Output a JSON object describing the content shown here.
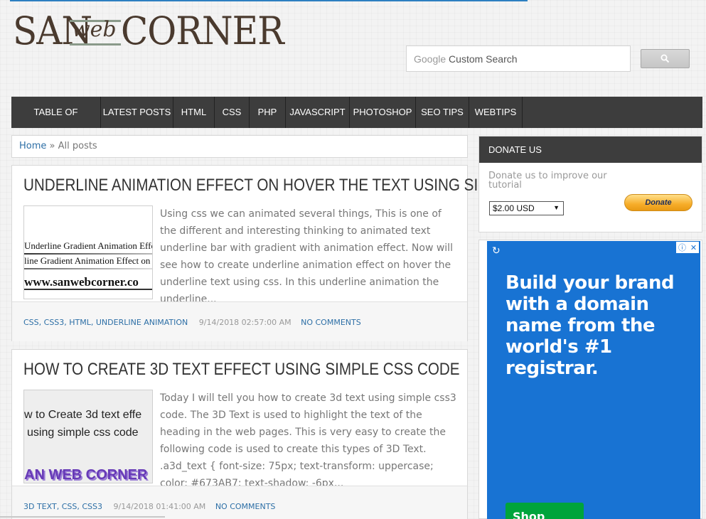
{
  "brand": {
    "san": "SAN",
    "web": "web",
    "corner": "CORNER"
  },
  "search": {
    "placeholder_google": "Google",
    "placeholder_text": "Custom Search"
  },
  "nav": [
    "TABLE OF CONTENT",
    "LATEST POSTS",
    "HTML",
    "CSS",
    "PHP",
    "JAVASCRIPT",
    "PHOTOSHOP",
    "SEO TIPS",
    "WEBTIPS"
  ],
  "breadcrumb": {
    "home": "Home",
    "sep": " » ",
    "current": "All posts"
  },
  "posts": [
    {
      "title": "UNDERLINE ANIMATION EFFECT ON HOVER THE TEXT USING SIMPLE CSS",
      "thumb_lines": [
        "Underline Gradient Animation Effe",
        "line Gradient Animation Effect on",
        "www.sanwebcorner.co"
      ],
      "snippet": "Using css we can animated several things, This is one of the different and interesting thinking to animated text underline bar with gradient with animation effect. Now will see how to create underline animation effect on hover the underline text using css. In this underline animation the underline...",
      "tags": "CSS, CSS3, HTML, UNDERLINE ANIMATION",
      "date": "9/14/2018 02:57:00 AM",
      "comments": "NO COMMENTS"
    },
    {
      "title": "HOW TO CREATE 3D TEXT EFFECT USING SIMPLE CSS CODE",
      "thumb_lines": [
        "w to Create 3d text effe",
        "using simple css code",
        "AN WEB CORNER"
      ],
      "snippet": "Today I will tell you how to create 3d text using simple css3 code. The 3D Text is used to highlight the text of the heading in the web pages. This is very easy to create the following code is used to create this types of 3D Text. .a3d_text { font-size: 75px; text-transform: uppercase; color: #673AB7; text-shadow: -6px...",
      "tags": "3D TEXT, CSS, CSS3",
      "date": "9/14/2018 01:41:00 AM",
      "comments": "NO COMMENTS"
    }
  ],
  "donate": {
    "heading": "DONATE US",
    "text": "Donate us to improve our tutorial",
    "amount": "$2.00 USD",
    "button": "Donate"
  },
  "ad": {
    "headline": "Build your brand with a domain name from the world's #1 registrar.",
    "cta": "Shop Now"
  },
  "colors": {
    "nav_bg": "#3d3d3d",
    "link": "#2d6fa6",
    "ad_blue": "#1873d3",
    "ad_green": "#00a43b"
  }
}
